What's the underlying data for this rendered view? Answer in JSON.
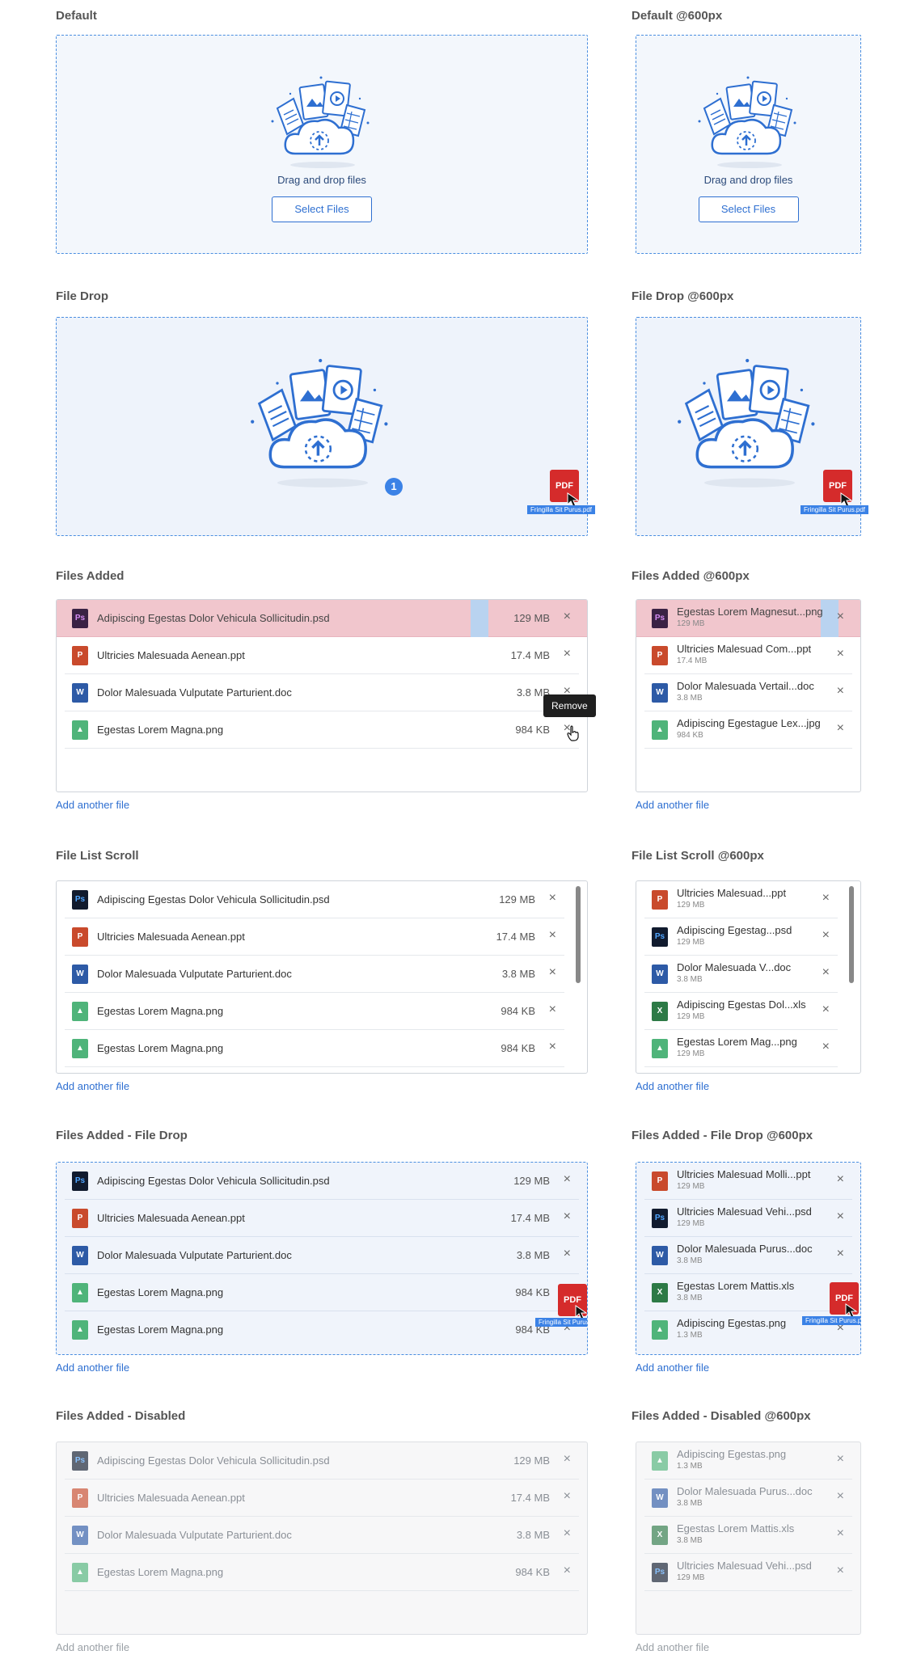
{
  "sections": {
    "default": "Default",
    "default600": "Default @600px",
    "filedrop": "File Drop",
    "filedrop600": "File Drop @600px",
    "added": "Files Added",
    "added600": "Files Added @600px",
    "scroll": "File List Scroll",
    "scroll600": "File List Scroll @600px",
    "addeddrop": "Files Added - File Drop",
    "addeddrop600": "Files Added - File Drop @600px",
    "disabled": "Files Added - Disabled",
    "disabled600": "Files Added - Disabled @600px"
  },
  "dropzone": {
    "text": "Drag and drop files",
    "button": "Select Files"
  },
  "add_another": "Add another file",
  "drag_file": {
    "icon_label": "PDF",
    "name": "Fringilla Sit Purus.pdf"
  },
  "drop_count": "1",
  "tooltip": "Remove",
  "close_glyph": "×",
  "icon_labels": {
    "ps": "Ps",
    "ppt": "P",
    "doc": "W",
    "img": "▲",
    "xls": "X"
  },
  "added": [
    {
      "name": "Adipiscing Egestas Dolor Vehicula Sollicitudin.psd",
      "size": "129 MB",
      "type": "ps",
      "error": true
    },
    {
      "name": "Ultricies Malesuada Aenean.ppt",
      "size": "17.4 MB",
      "type": "ppt"
    },
    {
      "name": "Dolor Malesuada Vulputate Parturient.doc",
      "size": "3.8 MB",
      "type": "doc"
    },
    {
      "name": "Egestas Lorem Magna.png",
      "size": "984 KB",
      "type": "img"
    }
  ],
  "added600": [
    {
      "name": "Egestas Lorem Magnesut...png",
      "size": "129 MB",
      "type": "ps",
      "error": true
    },
    {
      "name": "Ultricies Malesuad Com...ppt",
      "size": "17.4 MB",
      "type": "ppt"
    },
    {
      "name": "Dolor Malesuada Vertail...doc",
      "size": "3.8 MB",
      "type": "doc"
    },
    {
      "name": "Adipiscing Egestague Lex...jpg",
      "size": "984 KB",
      "type": "img"
    }
  ],
  "scroll": [
    {
      "name": "Adipiscing Egestas Dolor Vehicula Sollicitudin.psd",
      "size": "129 MB",
      "type": "ps"
    },
    {
      "name": "Ultricies Malesuada Aenean.ppt",
      "size": "17.4 MB",
      "type": "ppt"
    },
    {
      "name": "Dolor Malesuada Vulputate Parturient.doc",
      "size": "3.8 MB",
      "type": "doc"
    },
    {
      "name": "Egestas Lorem Magna.png",
      "size": "984 KB",
      "type": "img"
    },
    {
      "name": "Egestas Lorem Magna.png",
      "size": "984 KB",
      "type": "img"
    }
  ],
  "scroll600": [
    {
      "name": "Ultricies Malesuad...ppt",
      "size": "129 MB",
      "type": "ppt"
    },
    {
      "name": "Adipiscing Egestag...psd",
      "size": "129 MB",
      "type": "ps"
    },
    {
      "name": "Dolor Malesuada V...doc",
      "size": "3.8 MB",
      "type": "doc"
    },
    {
      "name": "Adipiscing Egestas Dol...xls",
      "size": "129 MB",
      "type": "xls"
    },
    {
      "name": "Egestas Lorem Mag...png",
      "size": "129 MB",
      "type": "img"
    }
  ],
  "addeddrop": [
    {
      "name": "Adipiscing Egestas Dolor Vehicula Sollicitudin.psd",
      "size": "129 MB",
      "type": "ps"
    },
    {
      "name": "Ultricies Malesuada Aenean.ppt",
      "size": "17.4 MB",
      "type": "ppt"
    },
    {
      "name": "Dolor Malesuada Vulputate Parturient.doc",
      "size": "3.8 MB",
      "type": "doc"
    },
    {
      "name": "Egestas Lorem Magna.png",
      "size": "984 KB",
      "type": "img"
    },
    {
      "name": "Egestas Lorem Magna.png",
      "size": "984 KB",
      "type": "img"
    }
  ],
  "addeddrop600": [
    {
      "name": "Ultricies Malesuad Molli...ppt",
      "size": "129 MB",
      "type": "ppt"
    },
    {
      "name": "Ultricies Malesuad Vehi...psd",
      "size": "129 MB",
      "type": "ps"
    },
    {
      "name": "Dolor Malesuada Purus...doc",
      "size": "3.8 MB",
      "type": "doc"
    },
    {
      "name": "Egestas Lorem Mattis.xls",
      "size": "3.8 MB",
      "type": "xls"
    },
    {
      "name": "Adipiscing Egestas.png",
      "size": "1.3 MB",
      "type": "img"
    }
  ],
  "disabled": [
    {
      "name": "Adipiscing Egestas Dolor Vehicula Sollicitudin.psd",
      "size": "129 MB",
      "type": "ps"
    },
    {
      "name": "Ultricies Malesuada Aenean.ppt",
      "size": "17.4 MB",
      "type": "ppt"
    },
    {
      "name": "Dolor Malesuada Vulputate Parturient.doc",
      "size": "3.8 MB",
      "type": "doc"
    },
    {
      "name": "Egestas Lorem Magna.png",
      "size": "984 KB",
      "type": "img"
    }
  ],
  "disabled600": [
    {
      "name": "Adipiscing Egestas.png",
      "size": "1.3 MB",
      "type": "img"
    },
    {
      "name": "Dolor Malesuada Purus...doc",
      "size": "3.8 MB",
      "type": "doc"
    },
    {
      "name": "Egestas Lorem Mattis.xls",
      "size": "3.8 MB",
      "type": "xls"
    },
    {
      "name": "Ultricies Malesuad Vehi...psd",
      "size": "129 MB",
      "type": "ps"
    }
  ],
  "colors": {
    "accent": "#2e6fd1",
    "error_row": "#f1c6cd",
    "pdf": "#d52b2b",
    "drop_bg": "#f3f7fc"
  }
}
